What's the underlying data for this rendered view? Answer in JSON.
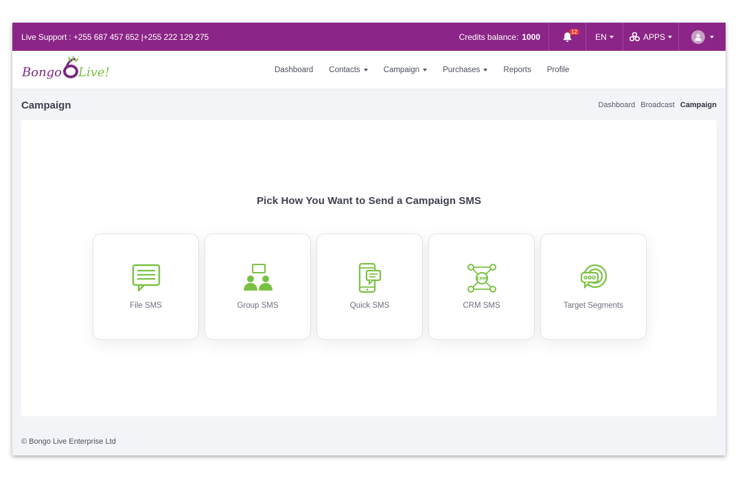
{
  "topbar": {
    "support_text": "Live Support  : +255 687 457 652 |+255 222 129 275",
    "credits_label": "Credits balance:",
    "credits_value": "1000",
    "notification_count": "12",
    "language": "EN",
    "apps_label": "APPS",
    "bar_color": "#8b2587"
  },
  "logo": {
    "text": "Bongo Live!"
  },
  "nav": {
    "items": [
      {
        "label": "Dashboard"
      },
      {
        "label": "Contacts"
      },
      {
        "label": "Campaign"
      },
      {
        "label": "Purchases"
      },
      {
        "label": "Reports"
      },
      {
        "label": "Profile"
      }
    ]
  },
  "page": {
    "title": "Campaign",
    "breadcrumb": [
      "Dashboard",
      "Broadcast",
      "Campaign"
    ]
  },
  "main": {
    "heading": "Pick How You Want to Send a Campaign SMS",
    "options": [
      {
        "label": "File SMS",
        "icon": "chat-lines-icon"
      },
      {
        "label": "Group SMS",
        "icon": "group-users-icon"
      },
      {
        "label": "Quick SMS",
        "icon": "phone-message-icon"
      },
      {
        "label": "CRM SMS",
        "icon": "crm-network-icon"
      },
      {
        "label": "Target Segments",
        "icon": "target-dots-icon"
      }
    ],
    "icon_color": "#7ac143"
  },
  "footer": {
    "text": "© Bongo Live Enterprise Ltd"
  }
}
